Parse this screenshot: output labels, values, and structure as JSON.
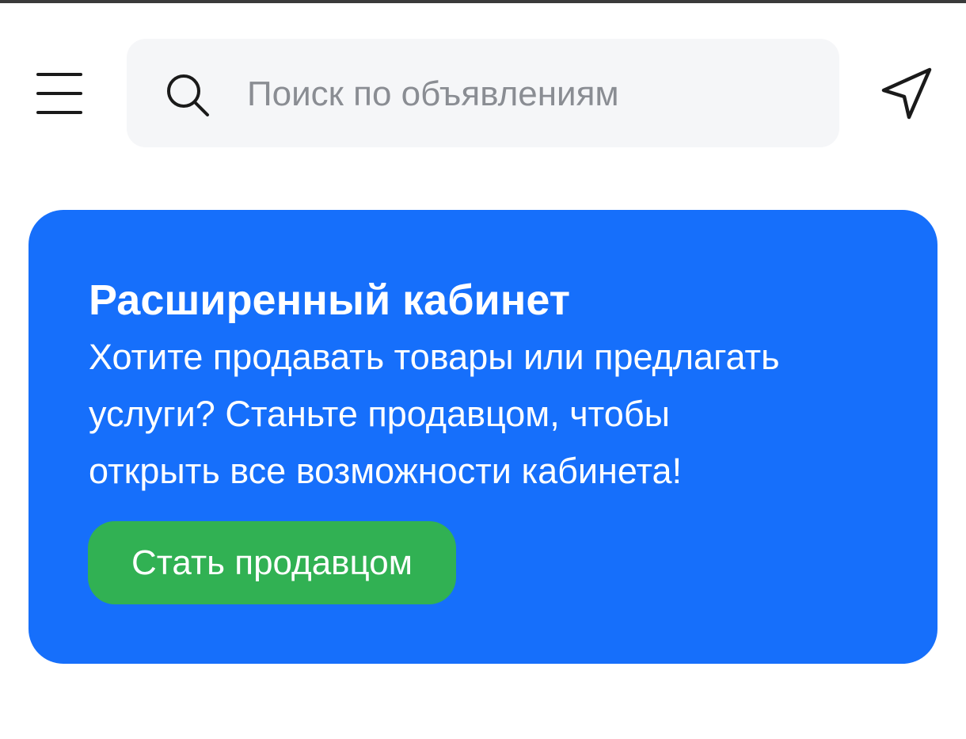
{
  "header": {
    "menu_icon": "hamburger-menu-icon",
    "search": {
      "icon": "search-icon",
      "placeholder": "Поиск по объявлениям"
    },
    "location_icon": "location-arrow-icon"
  },
  "banner": {
    "title": "Расширенный кабинет",
    "text_lines": [
      "Хотите продавать товары или предлагать",
      "услуги? Станьте продавцом, чтобы",
      "открыть все возможности кабинета!"
    ],
    "button_label": "Стать продавцом",
    "colors": {
      "background": "#166ffb",
      "button": "#31b153",
      "text": "#ffffff"
    }
  }
}
